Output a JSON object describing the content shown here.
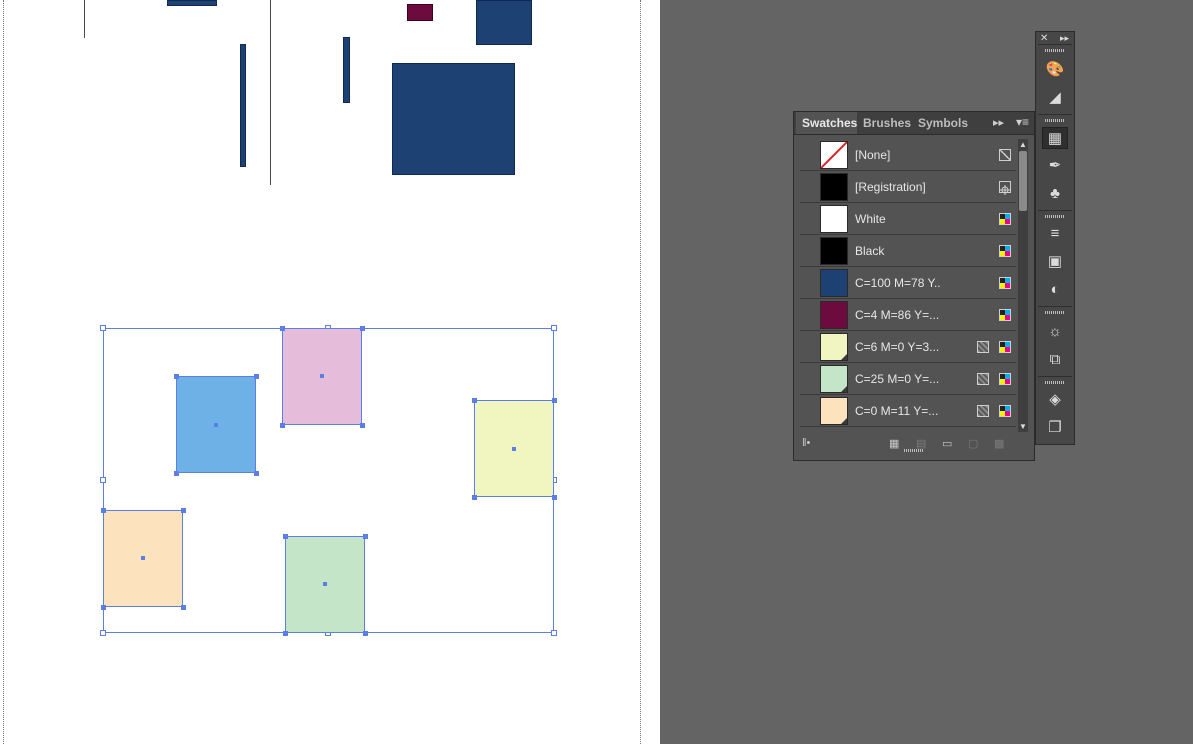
{
  "swatches_panel": {
    "tabs": [
      {
        "label": "Swatches"
      },
      {
        "label": "Brushes"
      },
      {
        "label": "Symbols"
      }
    ],
    "swatches": [
      {
        "name": "[None]",
        "color": "#ffffff"
      },
      {
        "name": "[Registration]",
        "color": "#000000"
      },
      {
        "name": "White",
        "color": "#ffffff"
      },
      {
        "name": "Black",
        "color": "#000000"
      },
      {
        "name": "C=100 M=78 Y..",
        "color": "#1c4172"
      },
      {
        "name": "C=4 M=86 Y=...",
        "color": "#6d0b3f"
      },
      {
        "name": "C=6 M=0 Y=3...",
        "color": "#f1f6c0"
      },
      {
        "name": "C=25 M=0 Y=...",
        "color": "#c4e5c8"
      },
      {
        "name": "C=0 M=11 Y=...",
        "color": "#fce2bd"
      }
    ]
  },
  "canvas": {
    "colors": {
      "navy": "#1c4172",
      "maroon": "#6d0b3f",
      "blue": "#6db1e6",
      "pink": "#e6bcdb",
      "yellow": "#f1f6c0",
      "green": "#c4e5c8",
      "peach": "#fce2bd",
      "selection": "#5b7fe6"
    }
  }
}
